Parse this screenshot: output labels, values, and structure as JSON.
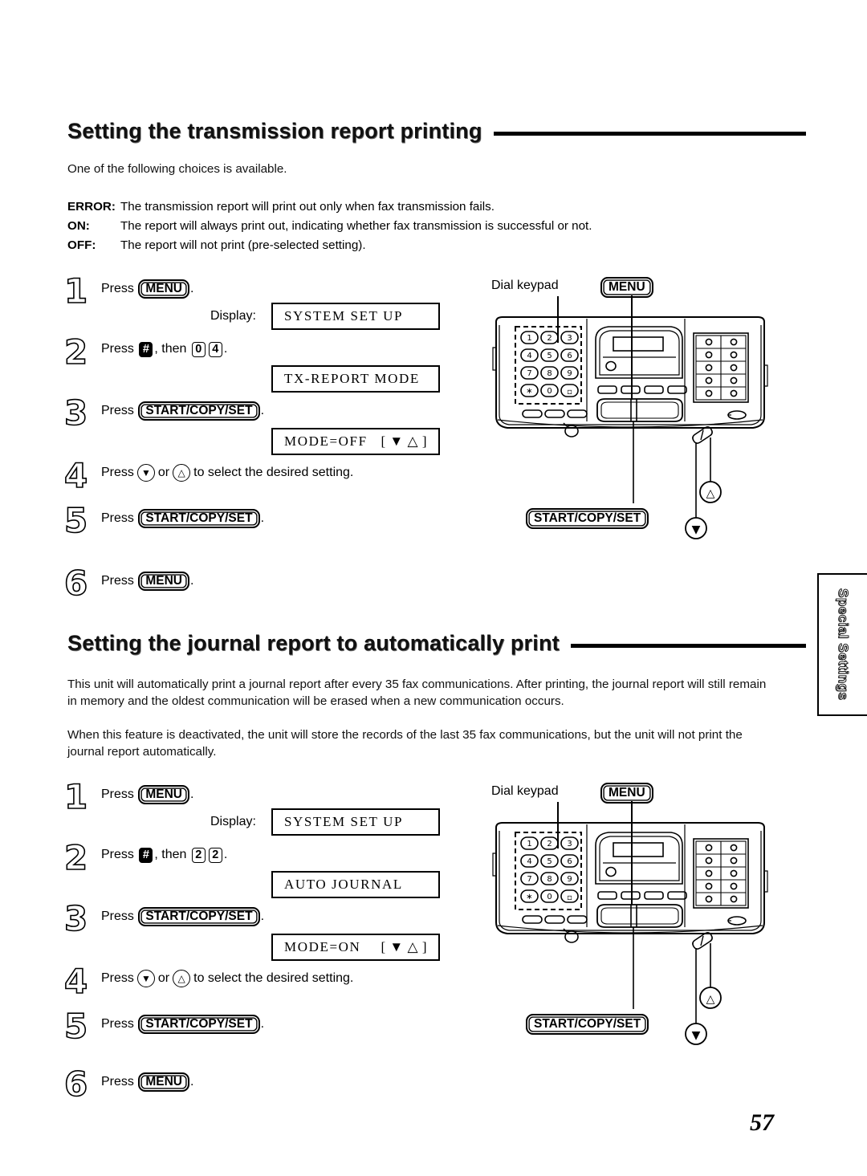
{
  "page": {
    "number": "57",
    "side_tab": "Special Settings"
  },
  "sections": [
    {
      "heading": "Setting the transmission report printing",
      "intro": "One of the following choices is available.",
      "choices": [
        {
          "key": "ERROR:",
          "text": "The transmission report will print out only when fax transmission fails."
        },
        {
          "key": "ON:",
          "text": "The report will always print out, indicating whether fax transmission is successful or not."
        },
        {
          "key": "OFF:",
          "text": "The report will not print (pre-selected setting)."
        }
      ],
      "steps": [
        {
          "num": "1",
          "press": "Press",
          "key": "MENU",
          "suffix": "."
        },
        {
          "num": "2",
          "press": "Press",
          "hashkey": "#",
          "then": ", then",
          "digits": [
            "0",
            "4"
          ],
          "suffix": "."
        },
        {
          "num": "3",
          "press": "Press",
          "key": "START/COPY/SET",
          "suffix": "."
        },
        {
          "num": "4",
          "press": "Press",
          "arrows": [
            "down",
            "up"
          ],
          "tail": "to select the desired setting."
        },
        {
          "num": "5",
          "press": "Press",
          "key": "START/COPY/SET",
          "suffix": "."
        },
        {
          "num": "6",
          "press": "Press",
          "key": "MENU",
          "suffix": "."
        }
      ],
      "display_label": "Display:",
      "lcd": [
        {
          "left": "SYSTEM SET UP",
          "right": ""
        },
        {
          "left": "TX-REPORT MODE",
          "right": ""
        },
        {
          "left": "MODE=OFF",
          "right": "[ ▼ △ ]"
        }
      ]
    },
    {
      "heading": "Setting the journal report to automatically print",
      "paragraphs": [
        "This unit will automatically print a journal report after every 35 fax communications. After printing, the journal report will still remain in memory and the oldest communication will be erased when a new communication occurs.",
        "When this feature is deactivated, the unit will store the records of the last 35 fax communications, but the unit will not print the journal report automatically."
      ],
      "steps": [
        {
          "num": "1",
          "press": "Press",
          "key": "MENU",
          "suffix": "."
        },
        {
          "num": "2",
          "press": "Press",
          "hashkey": "#",
          "then": ", then",
          "digits": [
            "2",
            "2"
          ],
          "suffix": "."
        },
        {
          "num": "3",
          "press": "Press",
          "key": "START/COPY/SET",
          "suffix": "."
        },
        {
          "num": "4",
          "press": "Press",
          "arrows": [
            "down",
            "up"
          ],
          "tail": "to select the desired setting."
        },
        {
          "num": "5",
          "press": "Press",
          "key": "START/COPY/SET",
          "suffix": "."
        },
        {
          "num": "6",
          "press": "Press",
          "key": "MENU",
          "suffix": "."
        }
      ],
      "display_label": "Display:",
      "lcd": [
        {
          "left": "SYSTEM SET UP",
          "right": ""
        },
        {
          "left": "AUTO JOURNAL",
          "right": ""
        },
        {
          "left": "MODE=ON",
          "right": "[ ▼ △ ]"
        }
      ]
    }
  ],
  "diagram": {
    "dial_keypad_label": "Dial keypad",
    "menu_label": "MENU",
    "start_copy_set_label": "START/COPY/SET",
    "keypad_keys": [
      "1",
      "2",
      "3",
      "4",
      "5",
      "6",
      "7",
      "8",
      "9",
      "∗",
      "0",
      "□"
    ],
    "nav_down": "▽",
    "nav_up": "△"
  }
}
